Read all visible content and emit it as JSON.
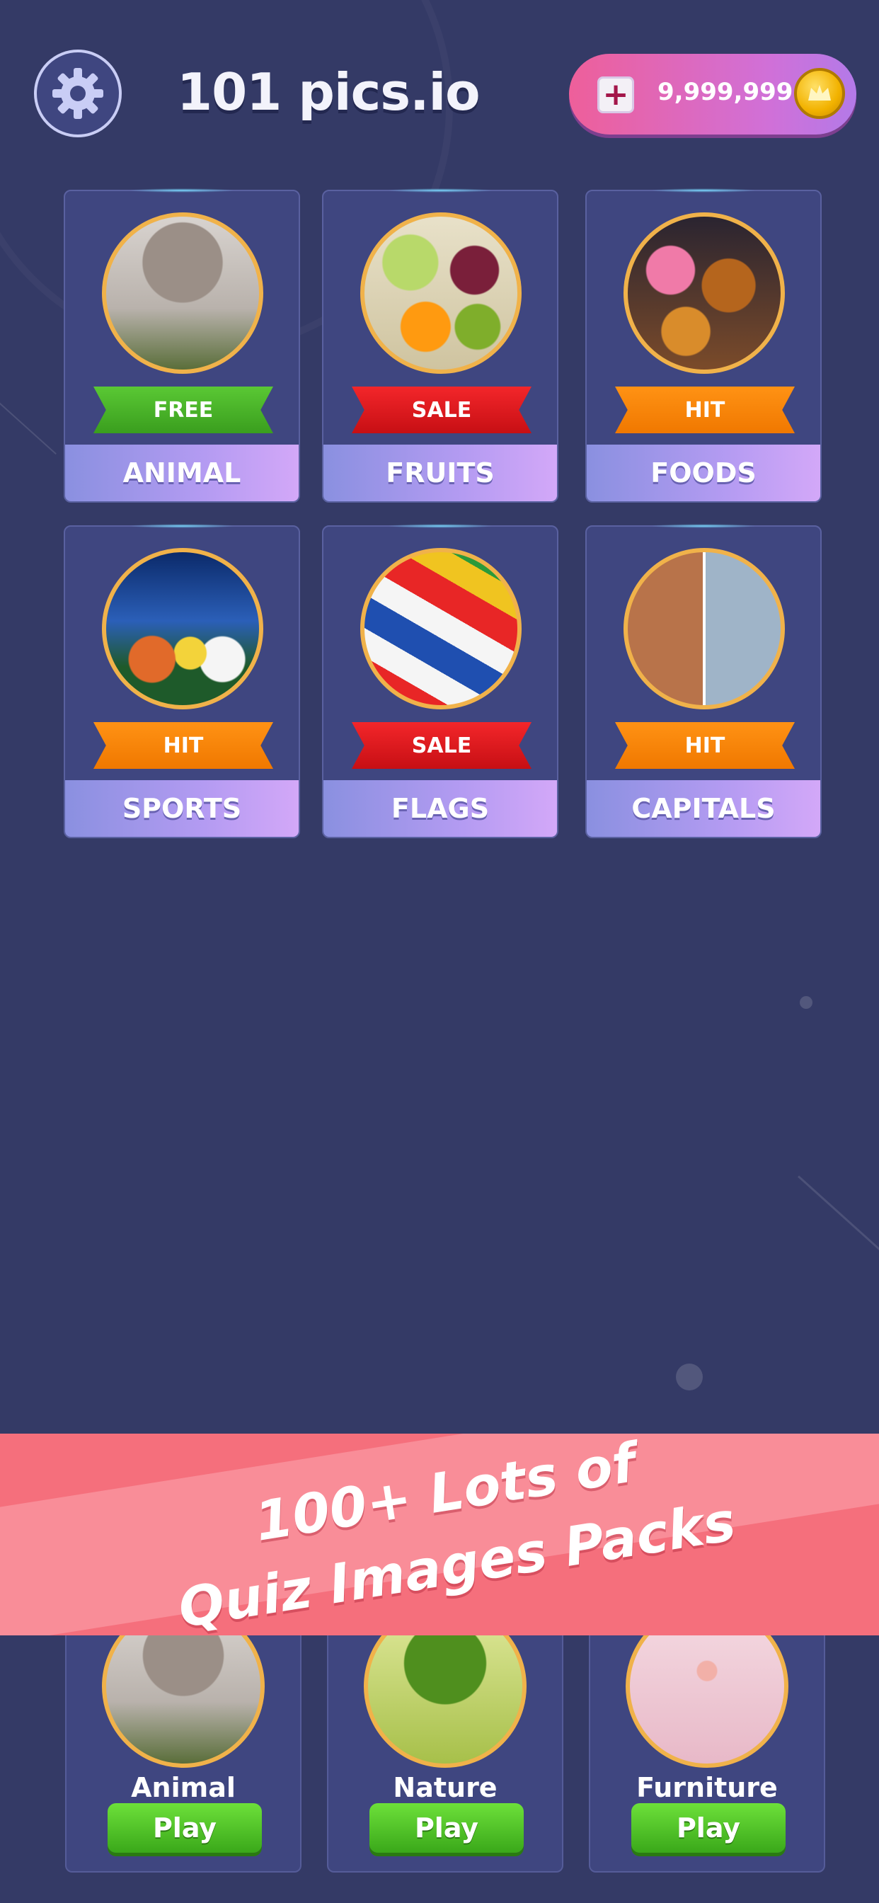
{
  "header": {
    "title": "101 pics.io",
    "coins": "9,999,999",
    "settings_icon": "gear-icon",
    "add_coins_icon": "plus-icon",
    "coin_icon": "coin-icon"
  },
  "categories": [
    {
      "label": "ANIMAL",
      "badge": "FREE",
      "badge_color": "#4cb62a"
    },
    {
      "label": "FRUITS",
      "badge": "SALE",
      "badge_color": "#e51a1f"
    },
    {
      "label": "FOODS",
      "badge": "HIT",
      "badge_color": "#ff8a10"
    },
    {
      "label": "SPORTS",
      "badge": "HIT",
      "badge_color": "#ff8a10"
    },
    {
      "label": "FLAGS",
      "badge": "SALE",
      "badge_color": "#e51a1f"
    },
    {
      "label": "CAPITALS",
      "badge": "HIT",
      "badge_color": "#ff8a10"
    }
  ],
  "promo": {
    "line1": "100+ Lots of",
    "line2": "Quiz Images Packs"
  },
  "packs": [
    {
      "name": "Animal",
      "play_label": "Play"
    },
    {
      "name": "Nature",
      "play_label": "Play"
    },
    {
      "name": "Furniture",
      "play_label": "Play"
    }
  ],
  "colors": {
    "background": "#343a66",
    "card": "#3f4680",
    "accent_pink": "#ee5f9a",
    "play_green": "#4cc22a"
  }
}
